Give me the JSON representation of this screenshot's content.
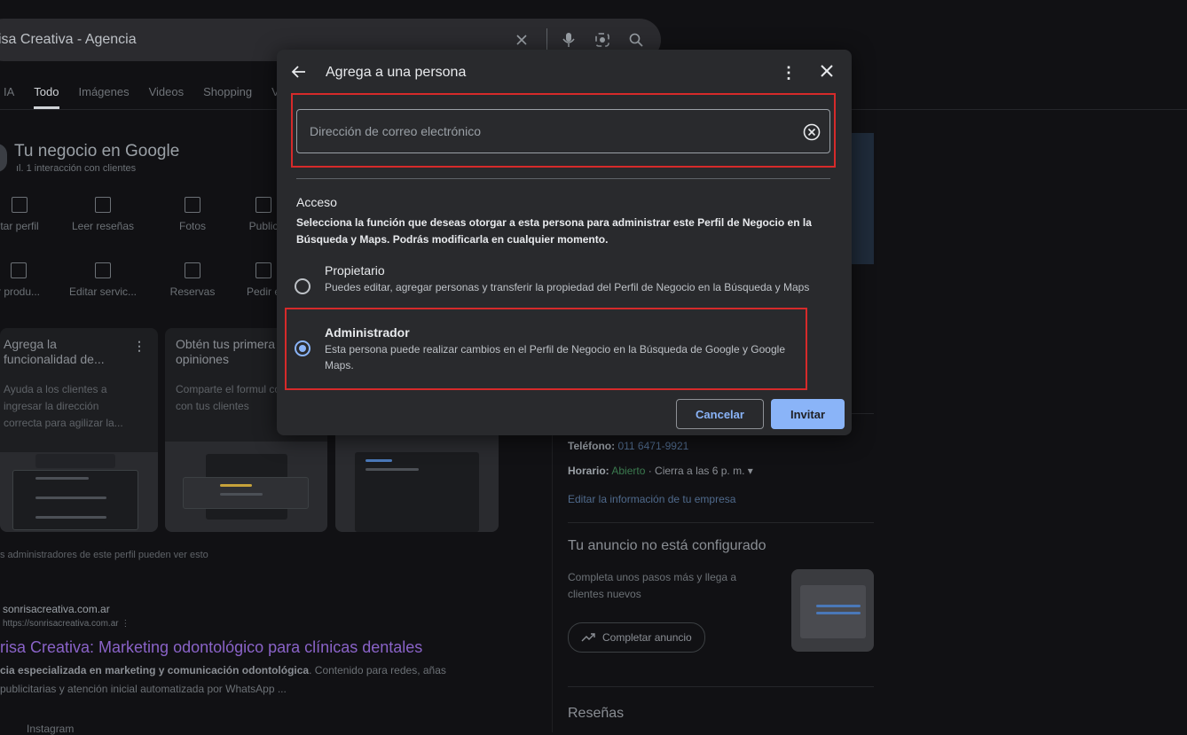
{
  "search": {
    "query": "isa Creativa - Agencia"
  },
  "tabs": [
    "IA",
    "Todo",
    "Imágenes",
    "Videos",
    "Shopping",
    "V"
  ],
  "business": {
    "title": "Tu negocio en Google",
    "interactions": "1 interacción con clientes",
    "actions_row1": [
      "tar perfil",
      "Leer reseñas",
      "Fotos",
      "Public"
    ],
    "actions_row2": [
      "r produ...",
      "Editar servic...",
      "Reservas",
      "Pedir e"
    ]
  },
  "cards": [
    {
      "title": "Agrega la funcionalidad de...",
      "body": "Ayuda a los clientes a ingresar la dirección correcta para agilizar la..."
    },
    {
      "title": "Obtén tus primera opiniones",
      "body": "Comparte el formul comentarios con tus clientes"
    }
  ],
  "admins_note": "s administradores de este perfil pueden ver esto",
  "result": {
    "site": "sonrisacreativa.com.ar",
    "url": "https://sonrisacreativa.com.ar ⋮",
    "title": "risa Creativa: Marketing odontológico para clínicas dentales",
    "desc_bold": "cia especializada en marketing y comunicación odontológica",
    "desc_rest": ". Contenido para redes, añas publicitarias y atención inicial automatizada por WhatsApp ...",
    "more": "Instagram"
  },
  "right_panel": {
    "phone_label": "Teléfono:",
    "phone": "011 6471-9921",
    "hours_label": "Horario:",
    "hours_open": "Abierto",
    "hours_rest": "· Cierra a las 6 p. m. ▾",
    "edit_link": "Editar la información de tu empresa",
    "ad_title": "Tu anuncio no está configurado",
    "ad_text": "Completa unos pasos más y llega a clientes nuevos",
    "ad_button": "Completar anuncio",
    "reviews_title": "Reseñas"
  },
  "modal": {
    "title": "Agrega a una persona",
    "email_placeholder": "Dirección de correo electrónico",
    "access_title": "Acceso",
    "access_desc": "Selecciona la función que deseas otorgar a esta persona para administrar este Perfil de Negocio en la Búsqueda y Maps. Podrás modificarla en cualquier momento.",
    "options": [
      {
        "title": "Propietario",
        "desc": "Puedes editar, agregar personas y transferir la propiedad del Perfil de Negocio en la Búsqueda y Maps",
        "selected": false
      },
      {
        "title": "Administrador",
        "desc": "Esta persona puede realizar cambios en el Perfil de Negocio en la Búsqueda de Google y Google Maps.",
        "selected": true
      }
    ],
    "cancel": "Cancelar",
    "invite": "Invitar"
  },
  "colors": {
    "accent": "#8ab4f8",
    "highlight": "#d62a2a",
    "modal_bg": "#292a2d",
    "page_bg": "#111114"
  }
}
